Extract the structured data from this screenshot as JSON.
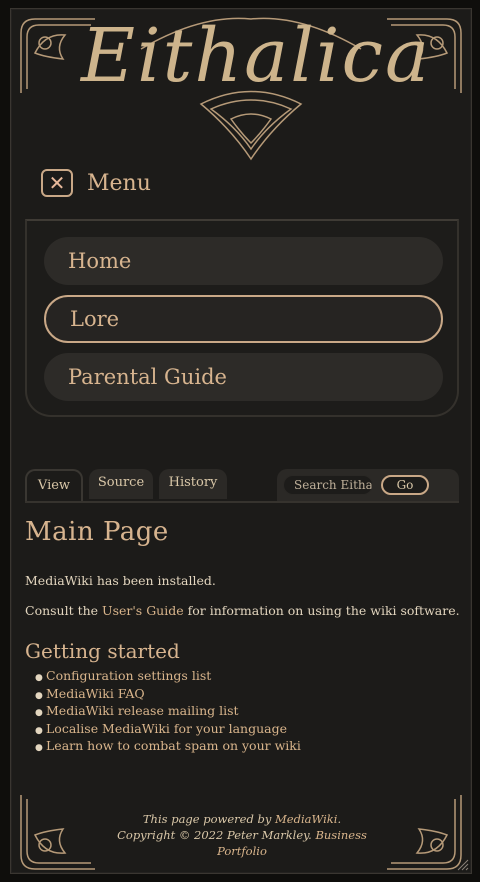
{
  "site": {
    "logo_text": "Eithalica"
  },
  "menu": {
    "label": "Menu",
    "toggle_icon": "close-icon"
  },
  "nav": {
    "items": [
      {
        "label": "Home"
      },
      {
        "label": "Lore"
      },
      {
        "label": "Parental Guide"
      }
    ]
  },
  "tabs": {
    "view": "View",
    "source": "Source",
    "history": "History"
  },
  "search": {
    "placeholder": "Search Eithalica",
    "go_label": "Go"
  },
  "content": {
    "title": "Main Page",
    "installed_text": "MediaWiki has been installed.",
    "consult_prefix": "Consult the ",
    "consult_link": "User's Guide",
    "consult_suffix": " for information on using the wiki software.",
    "getting_started": "Getting started",
    "links": [
      "Configuration settings list",
      "MediaWiki FAQ",
      "MediaWiki release mailing list",
      "Localise MediaWiki for your language",
      "Learn how to combat spam on your wiki"
    ]
  },
  "footer": {
    "powered_prefix": "This page powered by ",
    "powered_link": "MediaWiki",
    "powered_suffix": ".",
    "copyright": "Copyright © 2022 Peter Markley. ",
    "business_link_1": "Business",
    "business_link_2": "Portfolio"
  },
  "colors": {
    "accent": "#c9a887",
    "link": "#d9b58c",
    "background": "#1c1b19",
    "text": "#e3d6bf"
  }
}
